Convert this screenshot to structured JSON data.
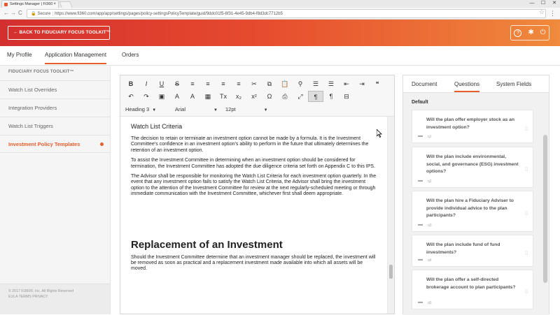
{
  "browser": {
    "tab_title": "Settings Manager | Fi360",
    "tab_close": "×",
    "win_min": "—",
    "win_max": "☐",
    "win_close": "✕",
    "back": "←",
    "forward": "→",
    "reload": "C",
    "secure_label": "Secure",
    "url": "https://www.fi360.com/app/app/settings/pages/policy-settingsPolicyTemplate/guid/9ddc01f5-6f31-4e45-9db4-f8d3dc7712b5",
    "star": "☆",
    "menu": "⋮"
  },
  "header": {
    "back_button": "← BACK TO FIDUCIARY FOCUS TOOLKIT™",
    "help_icon": "?",
    "settings_icon": "✱",
    "power_icon": "⏻"
  },
  "main_nav": {
    "items": [
      {
        "label": "My Profile"
      },
      {
        "label": "Application Management"
      },
      {
        "label": "Orders"
      }
    ]
  },
  "sidebar": {
    "heading": "FIDUCIARY FOCUS TOOLKIT™",
    "items": [
      {
        "label": "Watch List Overrides"
      },
      {
        "label": "Integration Providers"
      },
      {
        "label": "Watch List Triggers"
      },
      {
        "label": "Investment Policy Templates"
      }
    ],
    "footer_copyright": "© 2017 Fi360®, Inc. All Rights Reserved",
    "footer_links": "EULA  TERMS  PRIVACY"
  },
  "editor": {
    "format_block": "Heading 3",
    "font_family": "Arial",
    "font_size": "12pt",
    "caret": "▼",
    "toolbar_row1": [
      "B",
      "I",
      "U",
      "S",
      "≡",
      "≡",
      "≡",
      "≡",
      "✂",
      "⧉",
      "📋",
      "⚲",
      "☰",
      "☰",
      "⇤",
      "⇥",
      "❝"
    ],
    "toolbar_row2": [
      "↶",
      "↷",
      "▣",
      "A",
      "A",
      "▦",
      "Tx",
      "x₂",
      "x²",
      "Ω",
      "⎙",
      "⤢",
      "¶",
      "¶",
      "⊟"
    ],
    "heading1": "Watch List Criteria",
    "para1": "The decision to retain or terminate an investment option cannot be made by a formula. It is the Investment Committee’s confidence in an investment option’s ability to perform in the future that ultimately determines the retention of an investment option.",
    "para2": "To assist the Investment Committee in determining when an investment option should be considered for termination, the Investment Committee has adopted the due diligence criteria set forth on Appendix C to this IPS.",
    "para3": "The Advisor shall be responsible for monitoring the Watch List Criteria for each investment option quarterly. In the event that any investment option fails to satisfy the Watch List Criteria, the Advisor shall bring the investment option to the attention of the Investment Committee for review at the next regularly-scheduled meeting or through immediate communication with the Investment Committee, whichever first shall deem appropriate.",
    "heading2": "Replacement of an Investment",
    "para4": "Should the Investment Committee determine that an investment manager should be replaced, the investment will be removed as soon as practical and a replacement investment made available into which all assets will be moved."
  },
  "right_panel": {
    "tabs": [
      {
        "label": "Document"
      },
      {
        "label": "Questions"
      },
      {
        "label": "System Fields"
      }
    ],
    "group_label": "Default",
    "questions": [
      {
        "text": "Will the plan offer employer stock as an investment option?",
        "id": "q1"
      },
      {
        "text": "Will the plan include environmental, social, and governance (ESG) investment options?",
        "id": "q2"
      },
      {
        "text": "Will the plan hire a Fiduciary Adviser to provide individual advice to the plan participants?",
        "id": "q3"
      },
      {
        "text": "Will the plan include fund of fund investments?",
        "id": "q4"
      },
      {
        "text": "Will the plan offer a self-directed brokerage account to plan participants?",
        "id": "q5"
      }
    ],
    "comment_icon": "▬",
    "trash_icon": "▯"
  },
  "colors": {
    "accent": "#e85c2b",
    "header_start": "#d32f2f",
    "header_end": "#f08a3c"
  }
}
